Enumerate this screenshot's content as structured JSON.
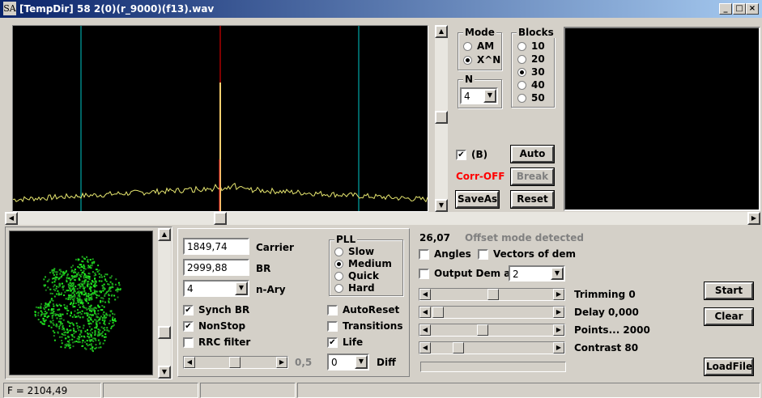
{
  "window": {
    "logo": "SA",
    "title": "[TempDir] 58 2(0)(r_9000)(f13).wav",
    "min": "_",
    "max": "□",
    "close": "×"
  },
  "mode": {
    "caption": "Mode",
    "options": [
      "AM",
      "X^N"
    ],
    "selected": 1
  },
  "blocks": {
    "caption": "Blocks",
    "options": [
      "10",
      "20",
      "30",
      "40",
      "50"
    ],
    "selected": 2
  },
  "n": {
    "caption": "N",
    "value": "4"
  },
  "b_check": {
    "label": "(B)",
    "checked": true
  },
  "corr_status": {
    "text": "Corr-OFF",
    "color": "#ff0000"
  },
  "buttons": {
    "auto": "Auto",
    "break": "Break",
    "saveas": "SaveAs",
    "reset": "Reset",
    "start": "Start",
    "clear": "Clear",
    "loadfile": "LoadFile"
  },
  "carrier": {
    "value": "1849,74",
    "label": "Carrier"
  },
  "br": {
    "value": "2999,88",
    "label": "BR"
  },
  "nary": {
    "value": "4",
    "label": "n-Ary"
  },
  "checks_left": [
    {
      "label": "Synch BR",
      "checked": true
    },
    {
      "label": "NonStop",
      "checked": true
    },
    {
      "label": "RRC filter",
      "checked": false
    }
  ],
  "rrc_value": "0,5",
  "pll": {
    "caption": "PLL",
    "options": [
      "Slow",
      "Medium",
      "Quick",
      "Hard"
    ],
    "selected": 1
  },
  "checks_mid": [
    {
      "label": "AutoReset",
      "checked": false
    },
    {
      "label": "Transitions",
      "checked": false
    },
    {
      "label": "Life",
      "checked": true
    }
  ],
  "diff": {
    "value": "0",
    "label": "Diff"
  },
  "offset": {
    "value": "26,07",
    "status": "Offset mode detected"
  },
  "angles": {
    "label": "Angles",
    "checked": false
  },
  "vectors": {
    "label": "Vectors of dem",
    "checked": false
  },
  "output_dem": {
    "label": "Output Dem as",
    "checked": false,
    "value": "2"
  },
  "sliders": [
    {
      "label": "Trimming 0"
    },
    {
      "label": "Delay  0,000"
    },
    {
      "label": "Points... 2000"
    },
    {
      "label": "Contrast 80"
    }
  ],
  "statusbar": {
    "freq": "F = 2104,49"
  },
  "colors": {
    "spectrum_bg": "#000000",
    "marker_cyan": "#00c8c8",
    "carrier_red": "#ff0000",
    "trace": "#e8e870",
    "constellation": "#28c828"
  },
  "icons": {
    "check": "check-icon",
    "arrow_down": "arrow-down-icon",
    "arrow_left": "arrow-left-icon",
    "arrow_right": "arrow-right-icon",
    "arrow_up": "arrow-up-icon"
  }
}
